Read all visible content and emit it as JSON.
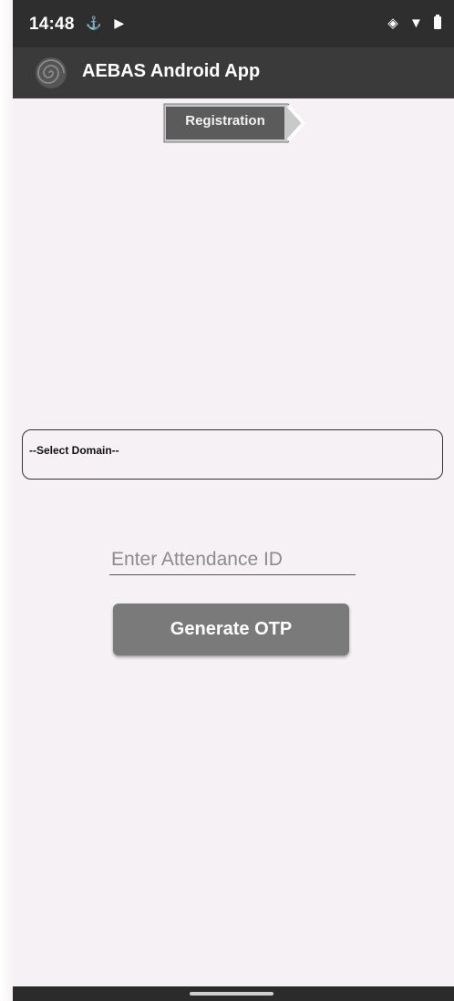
{
  "status_bar": {
    "time": "14:48",
    "left_icons": [
      "usb-icon",
      "play-icon"
    ],
    "right_icons": [
      "vibrate-icon",
      "wifi-icon",
      "battery-icon"
    ]
  },
  "app_bar": {
    "title": "AEBAS Android App",
    "logo_icon": "spiral-logo-icon"
  },
  "registration": {
    "label": "Registration"
  },
  "domain_select": {
    "selected": "--Select Domain--"
  },
  "attendance": {
    "placeholder": "Enter Attendance ID",
    "value": ""
  },
  "otp_button": {
    "label": "Generate OTP"
  },
  "colors": {
    "status_bar": "#2e2e2e",
    "app_bar": "#3a3a3a",
    "button": "#7a7a7a",
    "background": "#f5f1f4"
  }
}
